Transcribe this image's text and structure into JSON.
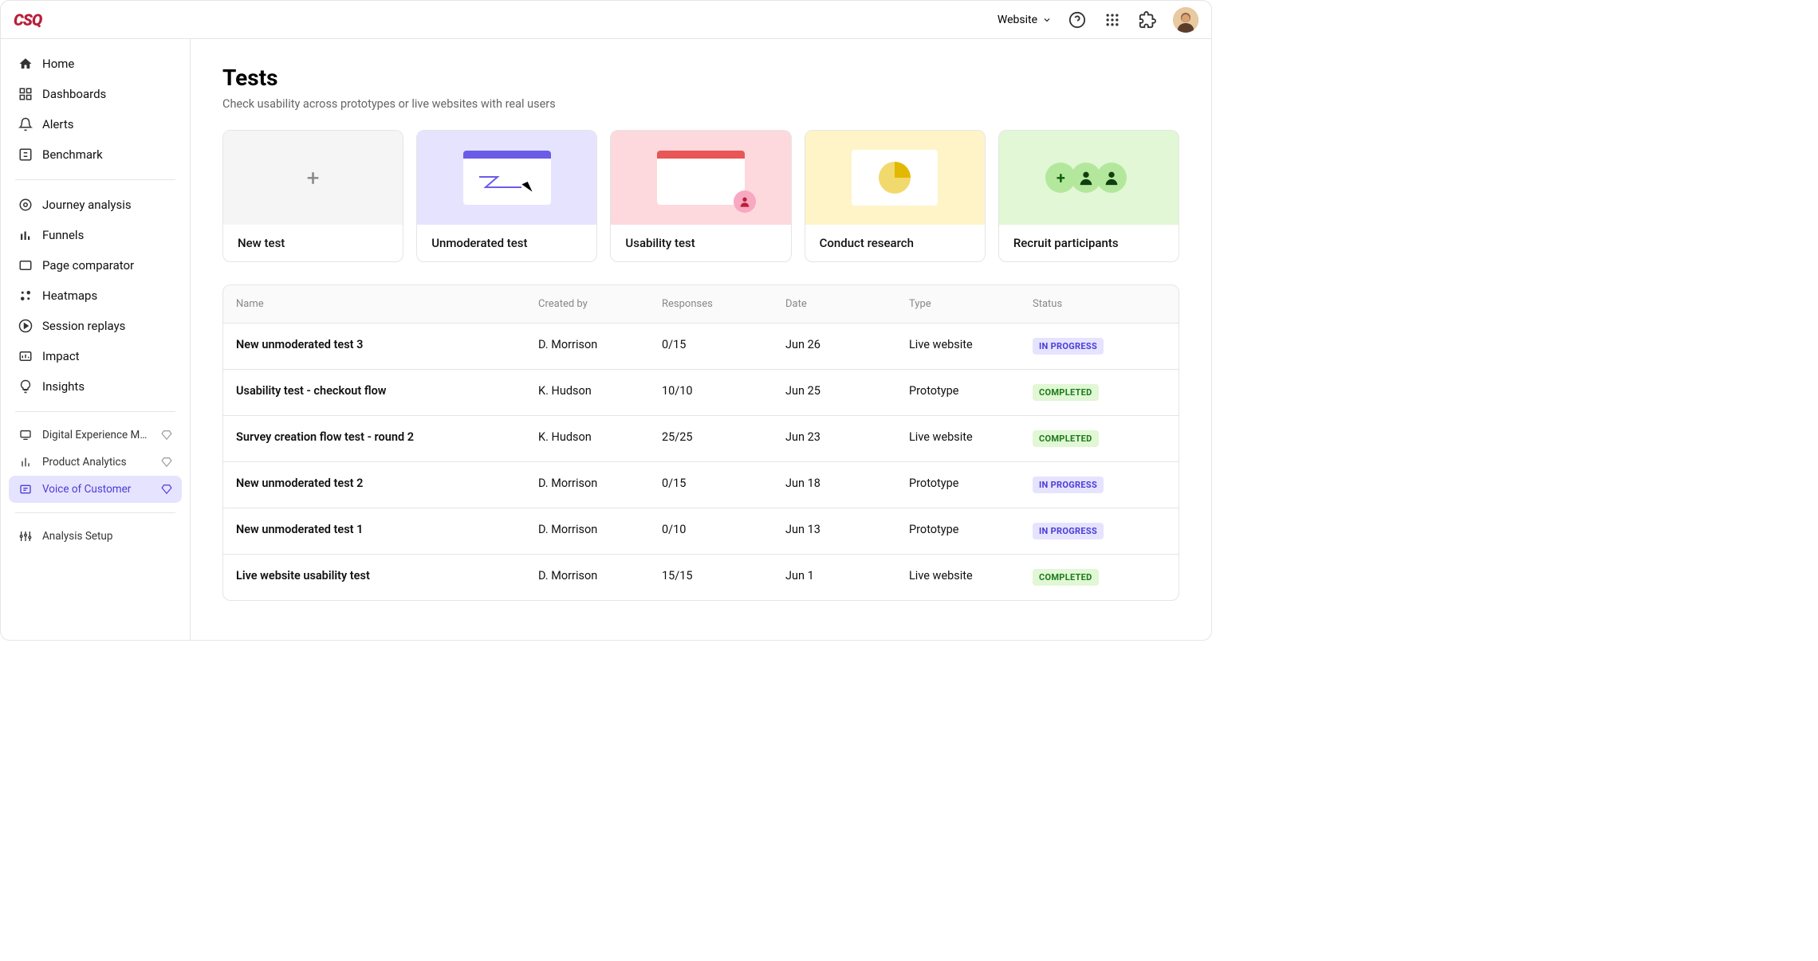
{
  "topbar": {
    "dropdown_label": "Website"
  },
  "sidebar": {
    "main": [
      {
        "label": "Home"
      },
      {
        "label": "Dashboards"
      },
      {
        "label": "Alerts"
      },
      {
        "label": "Benchmark"
      }
    ],
    "analysis": [
      {
        "label": "Journey analysis"
      },
      {
        "label": "Funnels"
      },
      {
        "label": "Page comparator"
      },
      {
        "label": "Heatmaps"
      },
      {
        "label": "Session replays"
      },
      {
        "label": "Impact"
      },
      {
        "label": "Insights"
      }
    ],
    "products": [
      {
        "label": "Digital Experience Monitor..."
      },
      {
        "label": "Product Analytics"
      },
      {
        "label": "Voice of Customer"
      }
    ],
    "footer": [
      {
        "label": "Analysis Setup"
      }
    ]
  },
  "page": {
    "title": "Tests",
    "subtitle": "Check usability across prototypes or live websites with real users"
  },
  "cards": [
    {
      "label": "New test"
    },
    {
      "label": "Unmoderated test"
    },
    {
      "label": "Usability test"
    },
    {
      "label": "Conduct research"
    },
    {
      "label": "Recruit participants"
    }
  ],
  "table": {
    "columns": [
      "Name",
      "Created by",
      "Responses",
      "Date",
      "Type",
      "Status"
    ],
    "rows": [
      {
        "name": "New unmoderated test 3",
        "creator": "D. Morrison",
        "responses": "0/15",
        "date": "Jun 26",
        "type": "Live website",
        "status": "IN PROGRESS",
        "status_kind": "inprogress"
      },
      {
        "name": "Usability test - checkout flow",
        "creator": "K. Hudson",
        "responses": "10/10",
        "date": "Jun 25",
        "type": "Prototype",
        "status": "COMPLETED",
        "status_kind": "completed"
      },
      {
        "name": "Survey creation flow test - round 2",
        "creator": "K. Hudson",
        "responses": "25/25",
        "date": "Jun 23",
        "type": "Live website",
        "status": "COMPLETED",
        "status_kind": "completed"
      },
      {
        "name": "New unmoderated test 2",
        "creator": "D. Morrison",
        "responses": "0/15",
        "date": "Jun 18",
        "type": "Prototype",
        "status": "IN PROGRESS",
        "status_kind": "inprogress"
      },
      {
        "name": "New unmoderated test 1",
        "creator": "D. Morrison",
        "responses": "0/10",
        "date": "Jun 13",
        "type": "Prototype",
        "status": "IN PROGRESS",
        "status_kind": "inprogress"
      },
      {
        "name": "Live website usability test",
        "creator": "D. Morrison",
        "responses": "15/15",
        "date": "Jun 1",
        "type": "Live website",
        "status": "COMPLETED",
        "status_kind": "completed"
      }
    ]
  }
}
